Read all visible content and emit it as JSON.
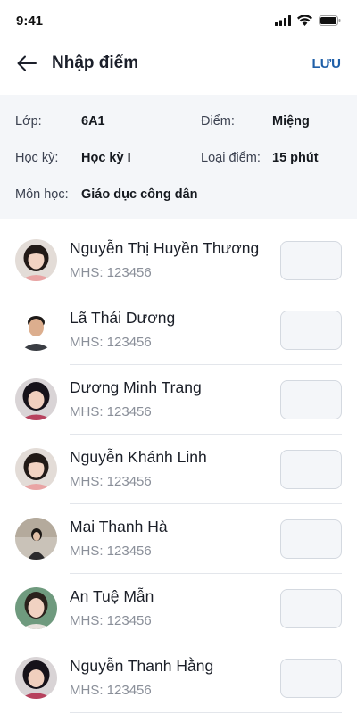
{
  "status": {
    "time": "9:41"
  },
  "header": {
    "title": "Nhập điểm",
    "save_label": "LƯU"
  },
  "info": {
    "class_label": "Lớp:",
    "class_value": "6A1",
    "score_label": "Điểm:",
    "score_value": "Miệng",
    "term_label": "Học kỳ:",
    "term_value": "Học kỳ I",
    "type_label": "Loại điểm:",
    "type_value": "15 phút",
    "subject_label": "Môn học:",
    "subject_value": "Giáo dục công dân"
  },
  "students": [
    {
      "name": "Nguyễn Thị Huyền Thương",
      "mhs": "MHS: 123456",
      "score": ""
    },
    {
      "name": "Lã Thái Dương",
      "mhs": "MHS: 123456",
      "score": ""
    },
    {
      "name": "Dương Minh Trang",
      "mhs": "MHS: 123456",
      "score": ""
    },
    {
      "name": "Nguyễn Khánh Linh",
      "mhs": "MHS: 123456",
      "score": ""
    },
    {
      "name": "Mai Thanh Hà",
      "mhs": "MHS: 123456",
      "score": ""
    },
    {
      "name": "An Tuệ Mẫn",
      "mhs": "MHS: 123456",
      "score": ""
    },
    {
      "name": "Nguyễn Thanh Hằng",
      "mhs": "MHS: 123456",
      "score": ""
    }
  ],
  "colors": {
    "accent": "#1f5fa8",
    "panel": "#f4f6f9",
    "input_border": "#d4d9e0"
  },
  "icons": {
    "back": "arrow-left-icon",
    "signal": "signal-icon",
    "wifi": "wifi-icon",
    "battery": "battery-icon"
  }
}
